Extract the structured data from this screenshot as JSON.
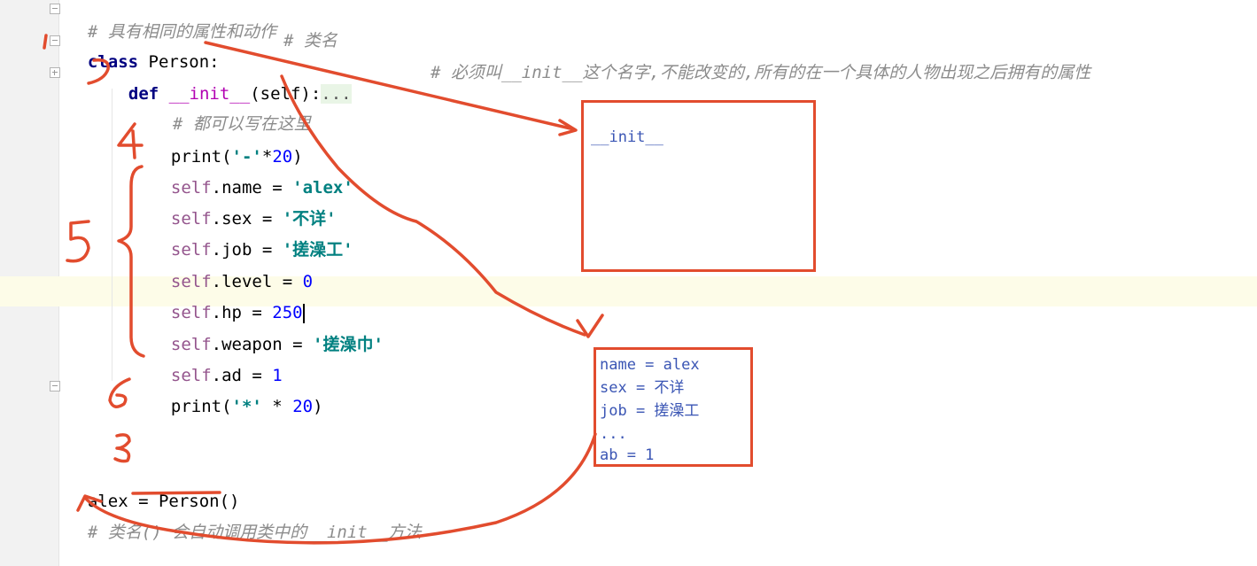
{
  "editor": {
    "lines": {
      "header_comment": "# 具有相同的属性和动作",
      "class_kw": "class",
      "class_name": " Person:",
      "class_comment": "# 类名",
      "def_kw": "def",
      "init_name": "__init__",
      "init_params": "(self):",
      "init_collapsed": "...",
      "init_comment": "# 必须叫__init__这个名字,不能改变的,所有的在一个具体的人物出现之后拥有的属性",
      "sub_comment": "# 都可以写在这里",
      "print1_fn": "print(",
      "print1_str": "'-'",
      "print1_rest": "*",
      "print1_num": "20",
      "print1_close": ")",
      "self_kw": "self",
      "name_attr": ".name = ",
      "name_val": "'alex'",
      "sex_attr": ".sex = ",
      "sex_val": "'不详'",
      "job_attr": ".job = ",
      "job_val": "'搓澡工'",
      "level_attr": ".level = ",
      "level_val": "0",
      "hp_attr": ".hp = ",
      "hp_val": "250",
      "weapon_attr": ".weapon = ",
      "weapon_val": "'搓澡巾'",
      "ad_attr": ".ad = ",
      "ad_val": "1",
      "print2_fn": "print(",
      "print2_str": "'*'",
      "print2_rest": " * ",
      "print2_num": "20",
      "print2_close": ")",
      "alex_assign": "alex = ",
      "person_call": "Person",
      "person_parens": "()",
      "footer_comment": "# 类名() 会自动调用类中的__init__方法"
    }
  },
  "annotations": {
    "init_box_label": "__init__",
    "obj_box_lines": [
      "name = alex",
      "sex = 不详",
      "job = 搓澡工",
      "...",
      "ab = 1"
    ],
    "color": "#e24c2e"
  }
}
